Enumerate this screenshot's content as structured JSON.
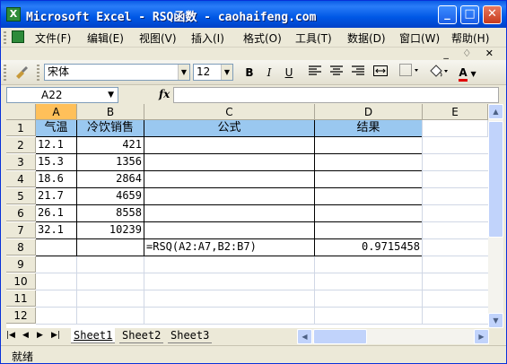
{
  "window": {
    "title": "Microsoft Excel - RSQ函数 - caohaifeng.com",
    "app_icon_letter": "X",
    "btn_min": "_",
    "btn_max": "□",
    "btn_close": "✕"
  },
  "menu": {
    "items": [
      "文件(F)",
      "编辑(E)",
      "视图(V)",
      "插入(I)",
      "格式(O)",
      "工具(T)",
      "数据(D)",
      "窗口(W)",
      "帮助(H)"
    ],
    "mdi_controls": "_ ♢ ✕"
  },
  "toolbar": {
    "font_name": "宋体",
    "font_size": "12",
    "bold": "B",
    "italic": "I",
    "underline": "U",
    "font_color_label": "A"
  },
  "formula_bar": {
    "name_box": "A22",
    "fx_label": "fx",
    "content": ""
  },
  "grid": {
    "columns": [
      "A",
      "B",
      "C",
      "D",
      "E"
    ],
    "rows": [
      "1",
      "2",
      "3",
      "4",
      "5",
      "6",
      "7",
      "8",
      "9",
      "10",
      "11",
      "12"
    ],
    "header_row": {
      "a": "气温",
      "b": "冷饮销售",
      "c": "公式",
      "d": "结果"
    },
    "data": [
      {
        "a": "12.1",
        "b": "421"
      },
      {
        "a": "15.3",
        "b": "1356"
      },
      {
        "a": "18.6",
        "b": "2864"
      },
      {
        "a": "21.7",
        "b": "4659"
      },
      {
        "a": "26.1",
        "b": "8558"
      },
      {
        "a": "32.1",
        "b": "10239"
      }
    ],
    "formula_cell": "=RSQ(A2:A7,B2:B7)",
    "result_cell": "0.9715458"
  },
  "sheets": {
    "tabs": [
      "Sheet1",
      "Sheet2",
      "Sheet3"
    ],
    "active": "Sheet1"
  },
  "status": {
    "text": "就绪"
  }
}
